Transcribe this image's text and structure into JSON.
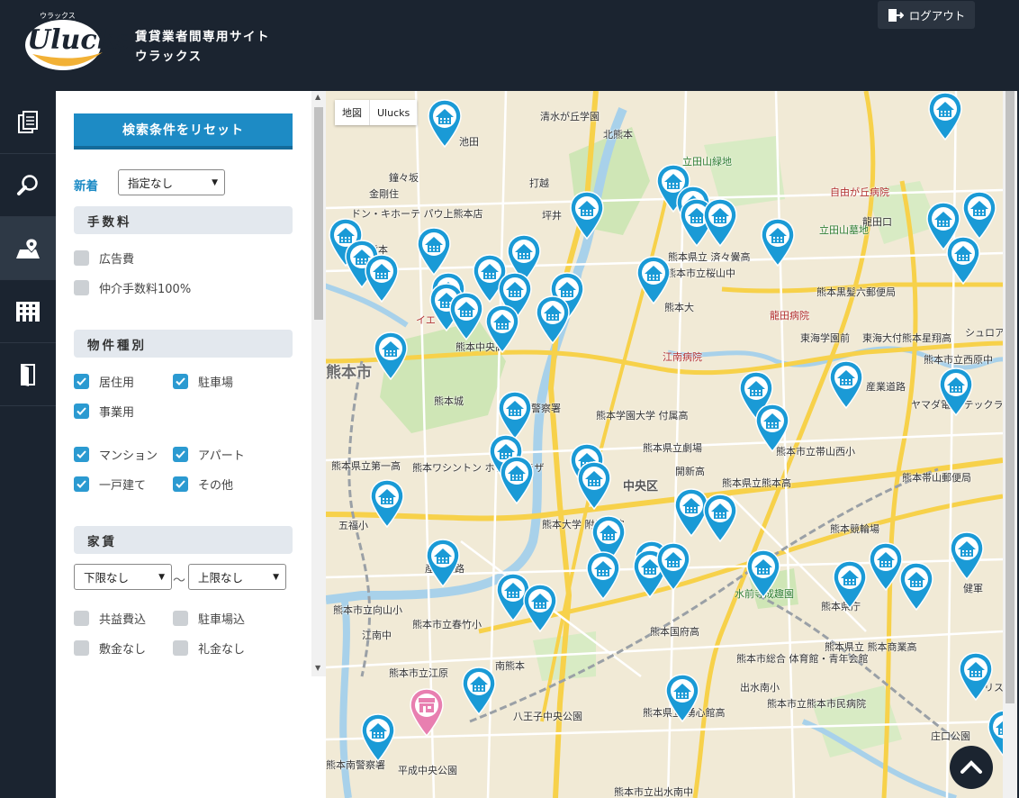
{
  "header": {
    "logo_text": "Ulucks!",
    "logo_ruby": "ウラックス",
    "title_line1": "賃貸業者間専用サイト",
    "title_line2": "ウラックス",
    "logout_label": "ログアウト"
  },
  "nav": {
    "items": [
      {
        "icon": "documents-icon"
      },
      {
        "icon": "search-icon"
      },
      {
        "icon": "map-pin-icon",
        "active": true
      },
      {
        "icon": "building-icon"
      },
      {
        "icon": "exit-door-icon"
      }
    ]
  },
  "filters": {
    "reset_label": "検索条件をリセット",
    "new_label": "新着",
    "new_value": "指定なし",
    "fee_section": "手数料",
    "fee_options": [
      {
        "label": "広告費",
        "checked": false
      },
      {
        "label": "仲介手数料100%",
        "checked": false
      }
    ],
    "type_section": "物件種別",
    "type_options": [
      {
        "label": "居住用",
        "checked": true
      },
      {
        "label": "駐車場",
        "checked": true
      },
      {
        "label": "事業用",
        "checked": true
      },
      {
        "label": "マンション",
        "checked": true
      },
      {
        "label": "アパート",
        "checked": true
      },
      {
        "label": "一戸建て",
        "checked": true
      },
      {
        "label": "その他",
        "checked": true
      }
    ],
    "rent_section": "家賃",
    "rent_min": "下限なし",
    "rent_max": "上限なし",
    "rent_tilde": "〜",
    "rent_options": [
      {
        "label": "共益費込",
        "checked": false
      },
      {
        "label": "駐車場込",
        "checked": false
      },
      {
        "label": "敷金なし",
        "checked": false
      },
      {
        "label": "礼金なし",
        "checked": false
      }
    ]
  },
  "map": {
    "type_map": "地図",
    "type_ulucks": "Ulucks",
    "labels": [
      "清水が丘学園",
      "北熊本",
      "池田",
      "立田山緑地",
      "鐘々坂",
      "金剛住",
      "自由が丘病院",
      "打越",
      "坪井",
      "龍田口",
      "ドン・キホーテ パウ上熊本店",
      "立田山墓地",
      "上熊本",
      "熊本県立 済々黌高",
      "熊本市立桜山中",
      "熊本黒髪六郵便局",
      "熊本大",
      "龍田病院",
      "イエ",
      "熊本中央高",
      "江南病院",
      "東海学園前",
      "東海大付熊本星翔高",
      "シュロア",
      "熊本市",
      "熊本市立西原中",
      "産業道路",
      "熊本城",
      "熊本北警察署",
      "熊本学園大学 付属高",
      "ヤマダ電機 テックランド熊本店",
      "熊本県立劇場",
      "熊本市立帯山西小",
      "熊本県立第一高",
      "開新高",
      "熊本ワシントン ホテルプラザ",
      "中央区",
      "熊本県立熊本高",
      "熊本帯山郵便局",
      "五福小",
      "熊本大学 附属病院",
      "熊本競輪場",
      "産業道路",
      "水前寺成趣園",
      "熊本県庁",
      "健軍",
      "熊本市立向山小",
      "熊本市立春竹小",
      "江南中",
      "熊本国府高",
      "熊本県立 熊本商業高",
      "熊本市総合 体育館・青年会館",
      "南熊本",
      "熊本市立江原",
      "出水南小",
      "八王子中央公園",
      "熊本県立 湧心館高",
      "熊本市立熊本市民病院",
      "熊本南警察署",
      "平成中央公園",
      "庄口公園",
      "熊本市立出水南中",
      "マリスト"
    ]
  }
}
